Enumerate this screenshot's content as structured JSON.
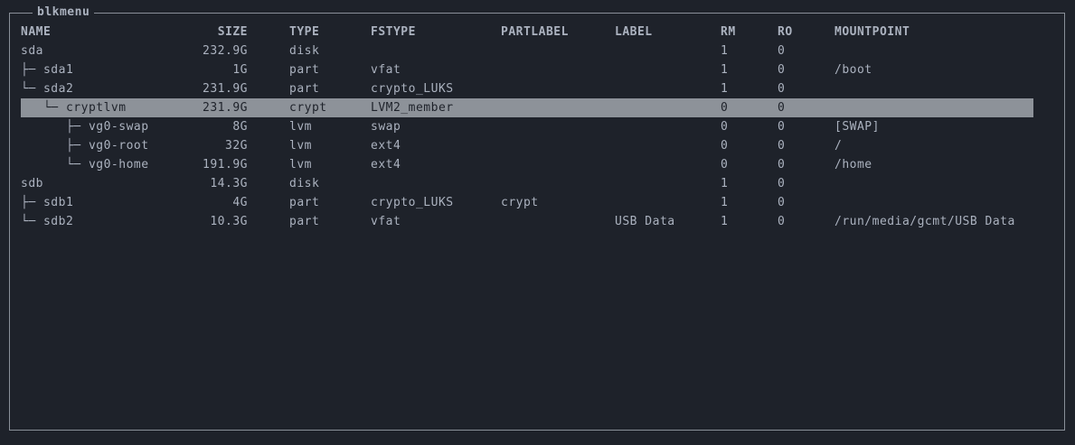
{
  "window": {
    "title": "blkmenu"
  },
  "columns": {
    "name": "NAME",
    "size": "SIZE",
    "type": "TYPE",
    "fstype": "FSTYPE",
    "partlabel": "PARTLABEL",
    "label": "LABEL",
    "rm": "RM",
    "ro": "RO",
    "mountpoint": "MOUNTPOINT"
  },
  "rows": [
    {
      "name": "sda",
      "size": "232.9G",
      "type": "disk",
      "fstype": "",
      "partlabel": "",
      "label": "",
      "rm": "1",
      "ro": "0",
      "mountpoint": ""
    },
    {
      "name": "├─ sda1",
      "size": "1G",
      "type": "part",
      "fstype": "vfat",
      "partlabel": "",
      "label": "",
      "rm": "1",
      "ro": "0",
      "mountpoint": "/boot"
    },
    {
      "name": "└─ sda2",
      "size": "231.9G",
      "type": "part",
      "fstype": "crypto_LUKS",
      "partlabel": "",
      "label": "",
      "rm": "1",
      "ro": "0",
      "mountpoint": ""
    },
    {
      "name": "   └─ cryptlvm",
      "size": "231.9G",
      "type": "crypt",
      "fstype": "LVM2_member",
      "partlabel": "",
      "label": "",
      "rm": "0",
      "ro": "0",
      "mountpoint": "",
      "selected": true
    },
    {
      "name": "      ├─ vg0-swap",
      "size": "8G",
      "type": "lvm",
      "fstype": "swap",
      "partlabel": "",
      "label": "",
      "rm": "0",
      "ro": "0",
      "mountpoint": "[SWAP]"
    },
    {
      "name": "      ├─ vg0-root",
      "size": "32G",
      "type": "lvm",
      "fstype": "ext4",
      "partlabel": "",
      "label": "",
      "rm": "0",
      "ro": "0",
      "mountpoint": "/"
    },
    {
      "name": "      └─ vg0-home",
      "size": "191.9G",
      "type": "lvm",
      "fstype": "ext4",
      "partlabel": "",
      "label": "",
      "rm": "0",
      "ro": "0",
      "mountpoint": "/home"
    },
    {
      "name": "sdb",
      "size": "14.3G",
      "type": "disk",
      "fstype": "",
      "partlabel": "",
      "label": "",
      "rm": "1",
      "ro": "0",
      "mountpoint": ""
    },
    {
      "name": "├─ sdb1",
      "size": "4G",
      "type": "part",
      "fstype": "crypto_LUKS",
      "partlabel": "crypt",
      "label": "",
      "rm": "1",
      "ro": "0",
      "mountpoint": ""
    },
    {
      "name": "└─ sdb2",
      "size": "10.3G",
      "type": "part",
      "fstype": "vfat",
      "partlabel": "",
      "label": "USB Data",
      "rm": "1",
      "ro": "0",
      "mountpoint": "/run/media/gcmt/USB Data"
    }
  ],
  "colors": {
    "background": "#1e222a",
    "text": "#abb2bf",
    "selection": "#8d9299",
    "border": "#8a9099"
  }
}
